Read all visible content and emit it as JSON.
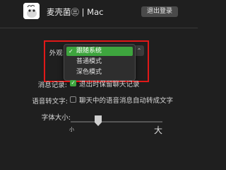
{
  "header": {
    "username": "麦壳菌㊂ | Mac",
    "logout_label": "退出登录"
  },
  "appearance": {
    "label": "外观:",
    "options": [
      {
        "label": "跟随系统",
        "selected": true
      },
      {
        "label": "普通模式",
        "selected": false
      },
      {
        "label": "深色模式",
        "selected": false
      }
    ]
  },
  "message_record": {
    "label": "消息记录:",
    "checked": true,
    "option_text": "退出时保留聊天记录"
  },
  "voice_to_text": {
    "label": "语音转文字:",
    "checked": false,
    "option_text": "聊天中的语音消息自动转成文字"
  },
  "font_size": {
    "label": "字体大小:",
    "small_label": "小",
    "large_label": "大",
    "level": 0.3
  },
  "colors": {
    "accent": "#3ea53e",
    "highlight": "#e01818",
    "background": "#1f1f1f"
  }
}
